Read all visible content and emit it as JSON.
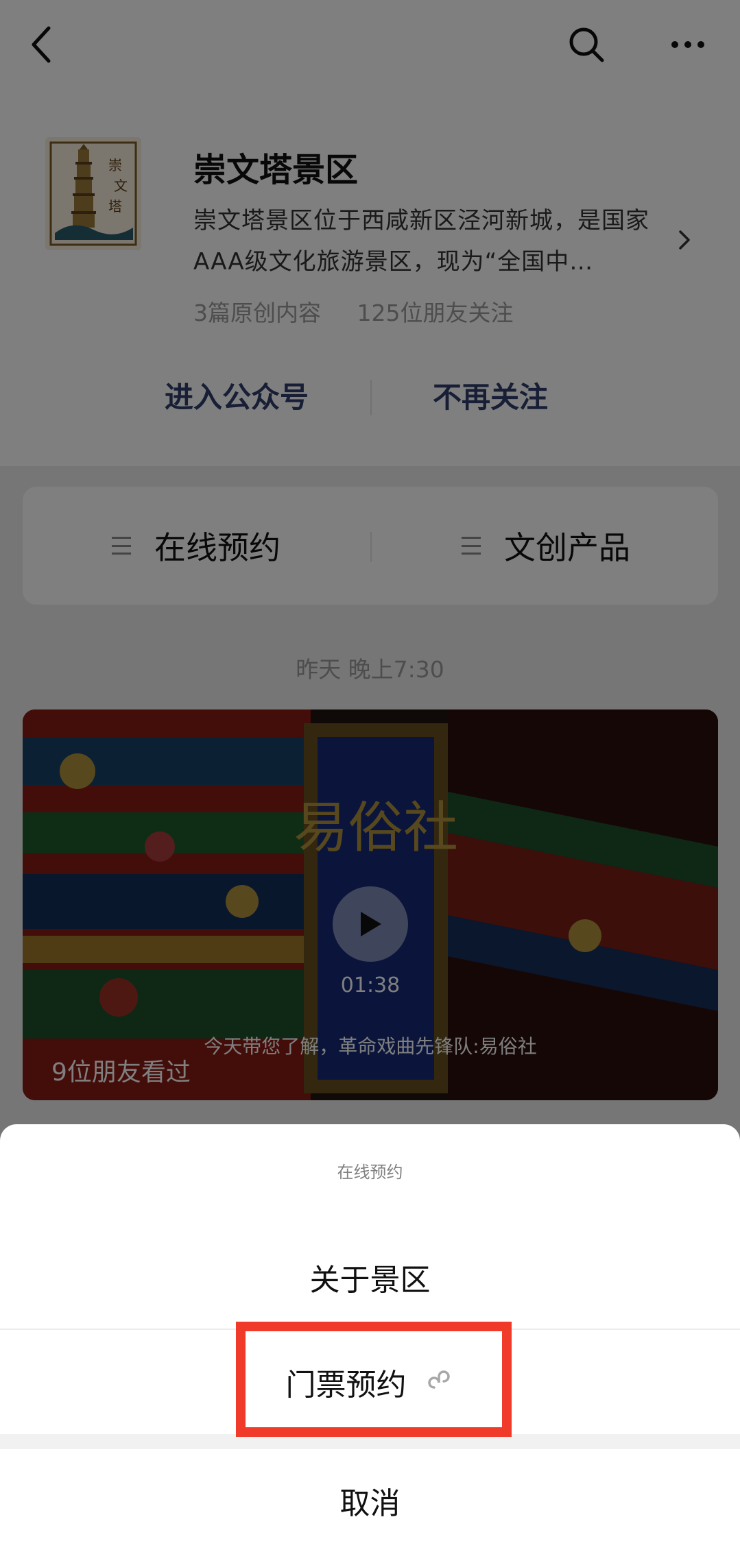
{
  "nav": {
    "back_icon": "chevron-left-icon",
    "search_icon": "search-icon",
    "more_icon": "more-dots-icon"
  },
  "account": {
    "logo_text": [
      "崇",
      "文",
      "塔"
    ],
    "name": "崇文塔景区",
    "description": "崇文塔景区位于西咸新区泾河新城，是国家AAA级文化旅游景区，现为“全国中…",
    "original_count": "3篇原创内容",
    "followers": "125位朋友关注",
    "enter_label": "进入公众号",
    "unfollow_label": "不再关注"
  },
  "menu": {
    "items": [
      {
        "label": "在线预约",
        "icon": "menu-list-icon"
      },
      {
        "label": "文创产品",
        "icon": "menu-list-icon"
      }
    ]
  },
  "feed": {
    "timestamp": "昨天 晚上7:30",
    "video": {
      "duration": "01:38",
      "subtitle": "今天带您了解，革命戏曲先锋队:易俗社",
      "friends_watched": "9位朋友看过",
      "sign_text": "易俗社"
    }
  },
  "sheet": {
    "title": "在线预约",
    "options": [
      {
        "label": "关于景区"
      },
      {
        "label": "门票预约",
        "icon": "mini-program-link-icon"
      }
    ],
    "cancel_label": "取消"
  },
  "colors": {
    "accent_text": "#2e3d6b",
    "highlight": "#f03a2a",
    "dim_overlay": "rgba(0,0,0,0.5)"
  }
}
